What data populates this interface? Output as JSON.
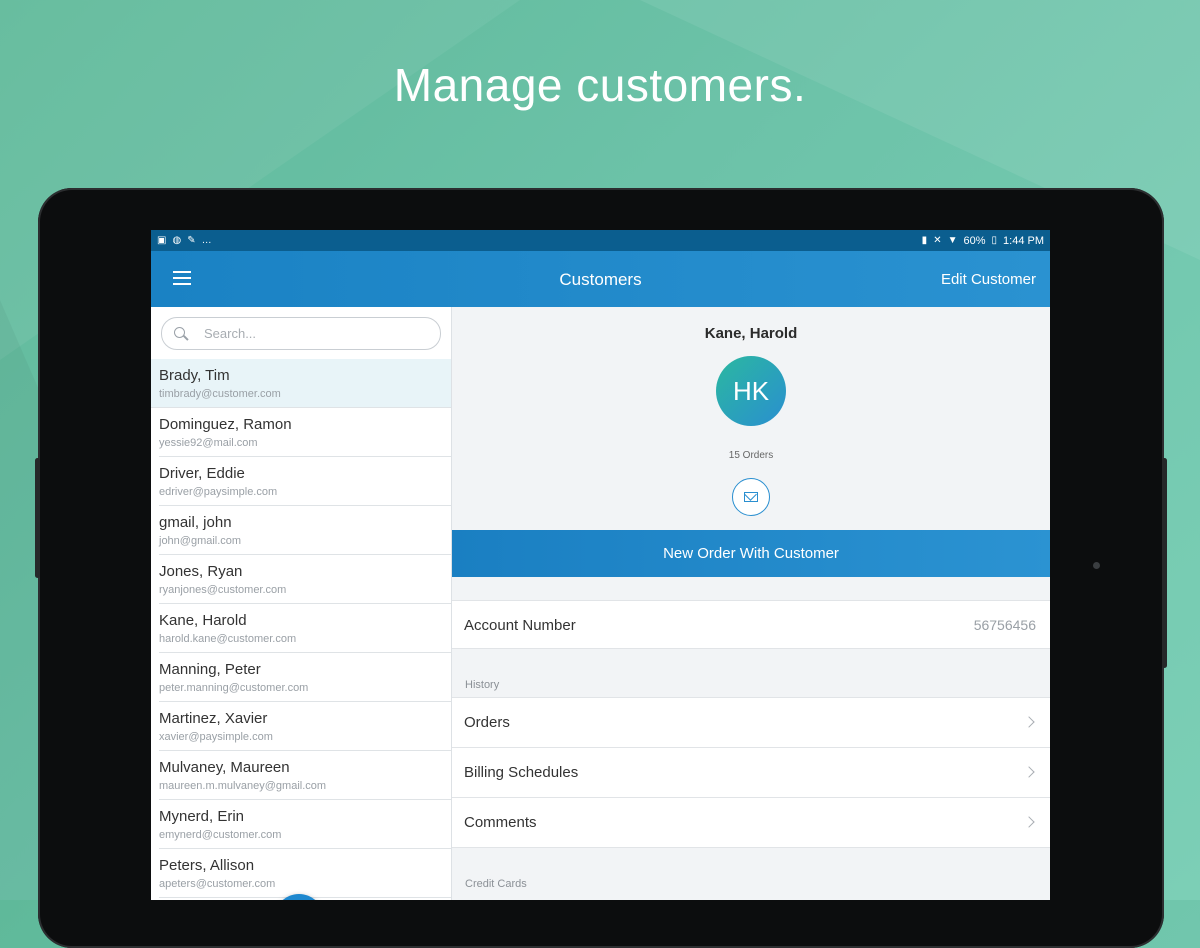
{
  "headline": "Manage customers.",
  "status_bar": {
    "battery": "60%",
    "time": "1:44 PM"
  },
  "app_bar": {
    "title": "Customers",
    "edit_label": "Edit Customer"
  },
  "search": {
    "placeholder": "Search..."
  },
  "customers": [
    {
      "name": "Brady, Tim",
      "email": "timbrady@customer.com",
      "selected": true
    },
    {
      "name": "Dominguez, Ramon",
      "email": "yessie92@mail.com"
    },
    {
      "name": "Driver, Eddie",
      "email": "edriver@paysimple.com"
    },
    {
      "name": "gmail, john",
      "email": "john@gmail.com"
    },
    {
      "name": "Jones, Ryan",
      "email": "ryanjones@customer.com"
    },
    {
      "name": "Kane, Harold",
      "email": "harold.kane@customer.com"
    },
    {
      "name": "Manning, Peter",
      "email": "peter.manning@customer.com"
    },
    {
      "name": "Martinez, Xavier",
      "email": "xavier@paysimple.com"
    },
    {
      "name": "Mulvaney, Maureen",
      "email": "maureen.m.mulvaney@gmail.com"
    },
    {
      "name": "Mynerd, Erin",
      "email": "emynerd@customer.com"
    },
    {
      "name": "Peters, Allison",
      "email": "apeters@customer.com"
    }
  ],
  "fab_label": "+",
  "detail": {
    "name": "Kane, Harold",
    "initials": "HK",
    "orders_count": "15 Orders",
    "new_order_label": "New Order With Customer",
    "account_label": "Account Number",
    "account_value": "56756456",
    "history_title": "History",
    "history_items": [
      "Orders",
      "Billing Schedules",
      "Comments"
    ],
    "credit_cards_title": "Credit Cards"
  },
  "colors": {
    "background": "#6cc2a8",
    "app_bar": "#1a82c4",
    "status_bar": "#0b5e8f",
    "accent": "#1e88cf"
  }
}
